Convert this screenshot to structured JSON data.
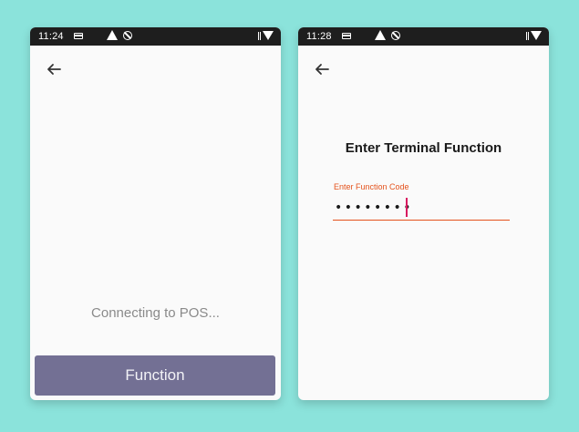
{
  "left_screen": {
    "status_time": "11:24",
    "status_text": "Connecting to POS...",
    "button_label": "Function"
  },
  "right_screen": {
    "status_time": "11:28",
    "title": "Enter Terminal Function",
    "field_label": "Enter Function Code",
    "field_value": "••••••••"
  },
  "colors": {
    "background": "#8be3db",
    "button": "#737094",
    "accent": "#e4521c",
    "caret": "#d81b60"
  },
  "icons": [
    "back-arrow-icon",
    "sim-card-icon",
    "warning-icon",
    "blocked-icon",
    "data-icon",
    "wifi-icon"
  ]
}
